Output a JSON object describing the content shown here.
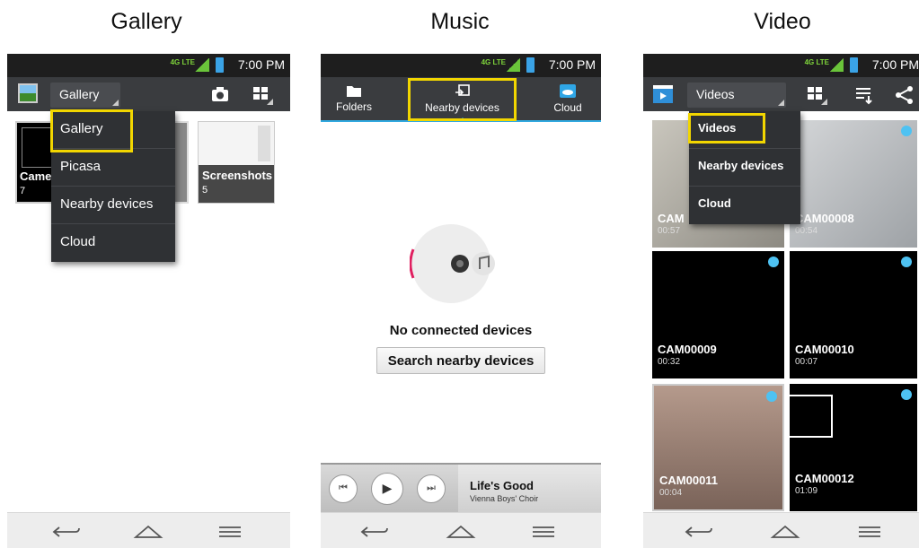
{
  "panels": {
    "gallery": {
      "heading": "Gallery",
      "status_time": "7:00 PM",
      "lte": "4G LTE",
      "spinner_label": "Gallery",
      "menu": [
        "Gallery",
        "Picasa",
        "Nearby devices",
        "Cloud"
      ],
      "albums": [
        {
          "name": "Came",
          "count": "7"
        },
        {
          "name": "Screenshots",
          "count": "5"
        }
      ]
    },
    "music": {
      "heading": "Music",
      "status_time": "7:00 PM",
      "lte": "4G LTE",
      "tabs": [
        "Folders",
        "Nearby devices",
        "Cloud"
      ],
      "empty_text": "No connected devices",
      "search_button": "Search nearby devices",
      "now_playing": {
        "title": "Life's Good",
        "artist": "Vienna Boys' Choir"
      }
    },
    "video": {
      "heading": "Video",
      "status_time": "7:00 PM",
      "lte": "4G LTE",
      "spinner_label": "Videos",
      "menu": [
        "Videos",
        "Nearby devices",
        "Cloud"
      ],
      "videos": [
        {
          "name": "CAM",
          "duration": "00:57"
        },
        {
          "name": "CAM00008",
          "duration": "00:54"
        },
        {
          "name": "CAM00009",
          "duration": "00:32"
        },
        {
          "name": "CAM00010",
          "duration": "00:07"
        },
        {
          "name": "CAM00011",
          "duration": "00:04"
        },
        {
          "name": "CAM00012",
          "duration": "01:09"
        }
      ]
    }
  },
  "colors": {
    "highlight": "#f2d600",
    "action_bar": "#3a3c3f",
    "status_bar": "#1e1e1e",
    "accent_blue": "#4ec2f2"
  },
  "icons": {
    "back": "back-arrow-icon",
    "home": "home-icon",
    "menu": "menu-lines-icon",
    "camera": "camera-icon",
    "grid": "grid-view-icon",
    "share": "share-icon",
    "sort": "sort-icon",
    "folder": "folder-icon",
    "cloud": "cloud-icon"
  }
}
